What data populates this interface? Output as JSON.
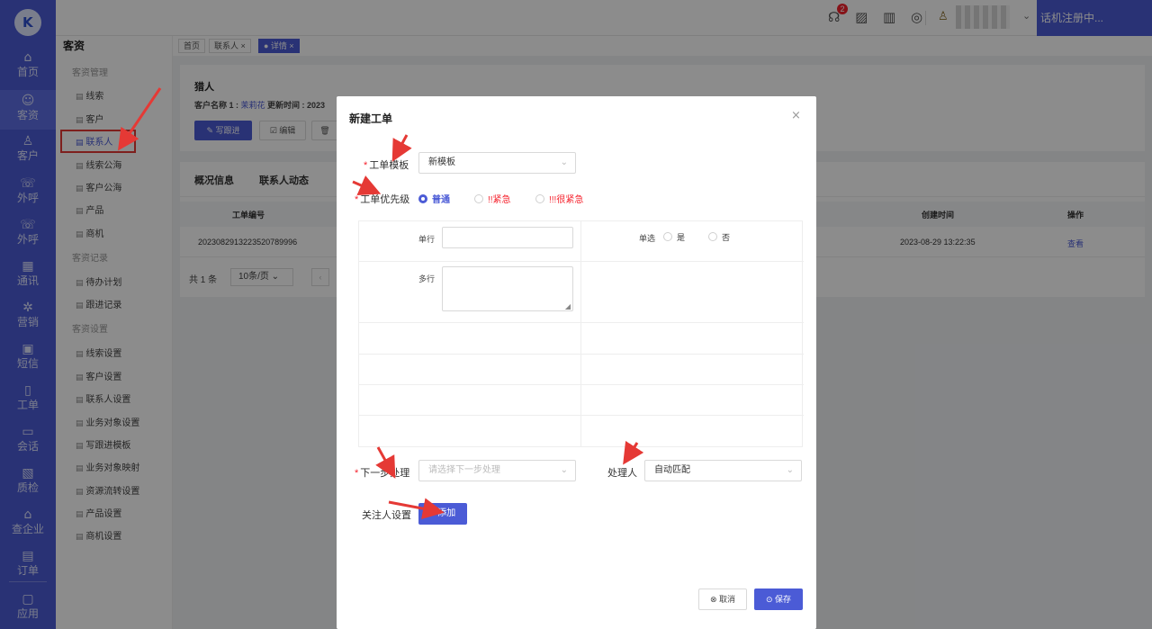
{
  "nav": {
    "items": [
      {
        "icon": "home-icon",
        "glyph": "⌂",
        "label": "首页"
      },
      {
        "icon": "customer-resource-icon",
        "glyph": "☺",
        "label": "客资"
      },
      {
        "icon": "customer-icon",
        "glyph": "♙",
        "label": "客户"
      },
      {
        "icon": "outbound-call-icon",
        "glyph": "☏",
        "label": "外呼"
      },
      {
        "icon": "outbound-call-2-icon",
        "glyph": "☏",
        "label": "外呼"
      },
      {
        "icon": "contacts-icon",
        "glyph": "▦",
        "label": "通讯"
      },
      {
        "icon": "marketing-icon",
        "glyph": "✲",
        "label": "营销"
      },
      {
        "icon": "sms-icon",
        "glyph": "▣",
        "label": "短信"
      },
      {
        "icon": "ticket-icon",
        "glyph": "▯",
        "label": "工单"
      },
      {
        "icon": "chat-icon",
        "glyph": "▭",
        "label": "会话"
      },
      {
        "icon": "quality-check-icon",
        "glyph": "▧",
        "label": "质检"
      },
      {
        "icon": "enterprise-icon",
        "glyph": "⌂",
        "label": "查企业"
      },
      {
        "icon": "order-icon",
        "glyph": "▤",
        "label": "订单"
      },
      {
        "icon": "apps-icon",
        "glyph": "▢",
        "label": "应用"
      }
    ]
  },
  "topbar": {
    "badge_count": "2",
    "icons": "☊ ▨ ▥ ◎",
    "user_glyph": "♙",
    "dropdown_glyph": "⌄",
    "phone_status": "话机注册中..."
  },
  "submenu": {
    "title": "客资",
    "group1": "客资管理",
    "items1": [
      "线索",
      "客户",
      "联系人",
      "线索公海",
      "客户公海",
      "产品",
      "商机"
    ],
    "group2": "客资记录",
    "items2": [
      "待办计划",
      "跟进记录"
    ],
    "group3": "客资设置",
    "items3": [
      "线索设置",
      "客户设置",
      "联系人设置",
      "业务对象设置",
      "写跟进模板",
      "业务对象映射",
      "资源流转设置",
      "产品设置",
      "商机设置"
    ]
  },
  "tabs": {
    "home": "首页",
    "contacts": "联系人 ×",
    "detail": "● 详情 ×"
  },
  "detail": {
    "title": "猎人",
    "meta_label": "客户名称 1 : ",
    "meta_customer": "茉莉花",
    "meta_update": "    更新时间 : 2023",
    "btn_followup": "✎ 写跟进",
    "btn_edit": "☑ 编辑",
    "btn_delete": "🗑"
  },
  "panel2": {
    "tab_overview": "概况信息",
    "tab_activity": "联系人动态",
    "col_ticket": "工单编号",
    "col_created": "创建时间",
    "col_action": "操作",
    "row_ticket": "20230829132235207899​96",
    "row_created": "2023-08-29 13:22:35",
    "row_action": "查看",
    "total": "共 1 条",
    "page_size": "10条/页  ⌄",
    "prev": "‹"
  },
  "modal": {
    "title": "新建工单",
    "close": "×",
    "template_label": "工单模板",
    "template_value": "新模板",
    "priority_label": "工单优先级",
    "priority_options": [
      "普通",
      "!!紧急",
      "!!!很紧急"
    ],
    "field_single_line": "单行",
    "field_single_choice": "单选",
    "choice_yes": "是",
    "choice_no": "否",
    "field_multi_line": "多行",
    "next_step_label": "下一步处理",
    "next_step_placeholder": "请选择下一步处理",
    "handler_label": "处理人",
    "handler_value": "自动匹配",
    "followers_label": "关注人设置",
    "add_button": "+ 添加",
    "cancel_button": "⊗ 取消",
    "save_button": "⊙ 保存",
    "chevron": "⌄"
  },
  "colors": {
    "primary": "#4b5bd6",
    "annotation": "#e53935"
  }
}
